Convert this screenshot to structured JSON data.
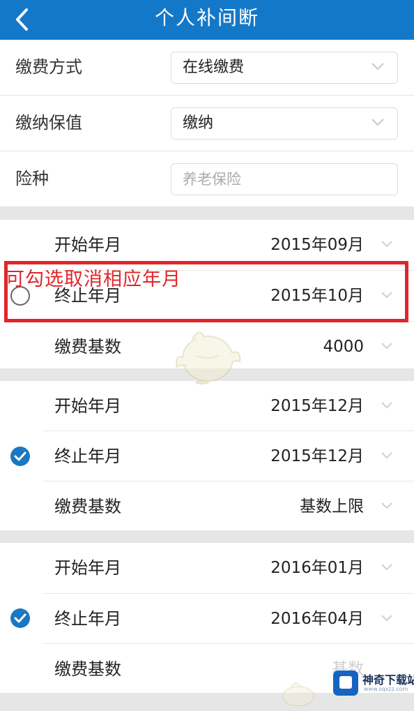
{
  "header": {
    "title": "个人补间断",
    "back_icon": "chevron-left-icon",
    "color": "#1478c8"
  },
  "form": {
    "payment_method": {
      "label": "缴费方式",
      "value": "在线缴费"
    },
    "payment_keep": {
      "label": "缴纳保值",
      "value": "缴纳"
    },
    "insurance_type": {
      "label": "险种",
      "placeholder": "养老保险"
    }
  },
  "annotation": {
    "text": "可勾选取消相应年月",
    "color": "#e0262b"
  },
  "periods": [
    {
      "checked": false,
      "start": {
        "label": "开始年月",
        "value": "2015年09月"
      },
      "end": {
        "label": "终止年月",
        "value": "2015年10月"
      },
      "base": {
        "label": "缴费基数",
        "value": "4000"
      }
    },
    {
      "checked": true,
      "start": {
        "label": "开始年月",
        "value": "2015年12月"
      },
      "end": {
        "label": "终止年月",
        "value": "2015年12月"
      },
      "base": {
        "label": "缴费基数",
        "value": "基数上限"
      }
    },
    {
      "checked": true,
      "start": {
        "label": "开始年月",
        "value": "2016年01月"
      },
      "end": {
        "label": "终止年月",
        "value": "2016年04月"
      },
      "base": {
        "label": "缴费基数",
        "value": "基数"
      }
    }
  ],
  "watermark": {
    "name": "神奇下载站",
    "url": "www.sqxzz.com"
  }
}
